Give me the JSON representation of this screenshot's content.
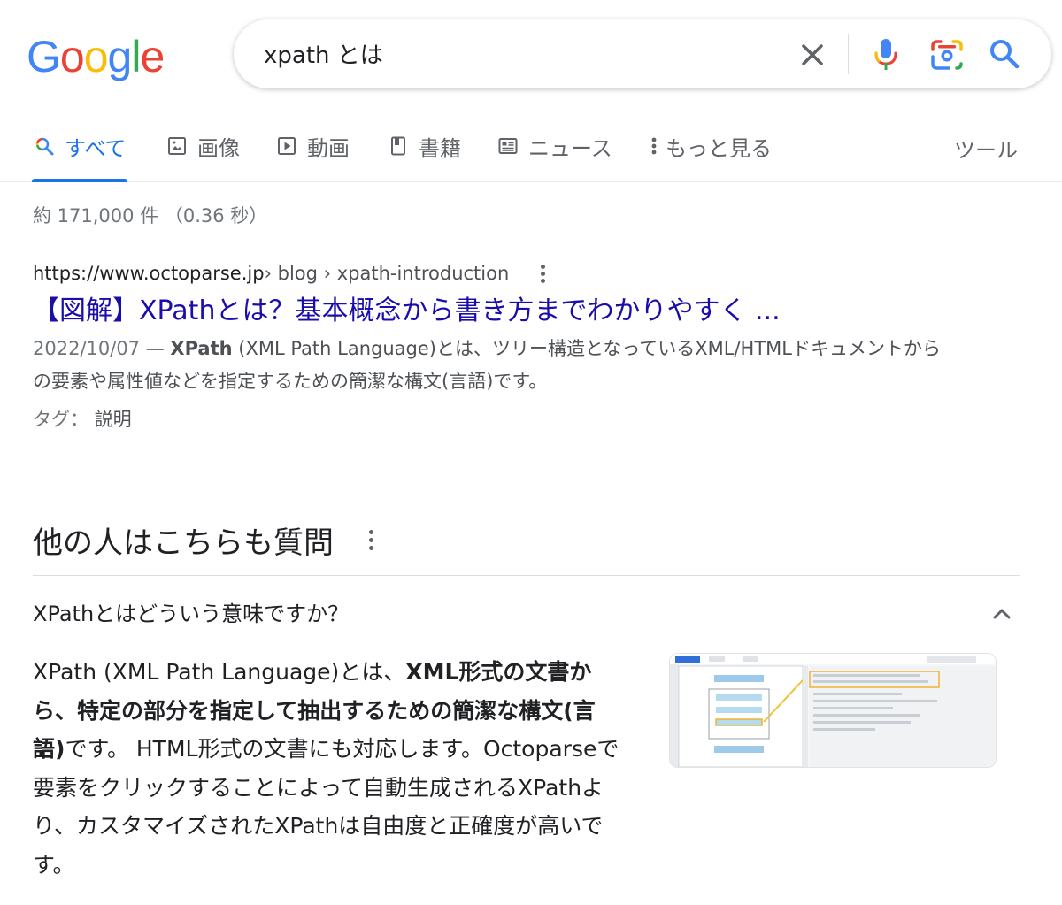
{
  "logo": {
    "letters": [
      "G",
      "o",
      "o",
      "g",
      "l",
      "e"
    ]
  },
  "search": {
    "query": "xpath とは"
  },
  "tabs": [
    {
      "label": "すべて",
      "icon": "search-icon",
      "active": true
    },
    {
      "label": "画像",
      "icon": "image-icon"
    },
    {
      "label": "動画",
      "icon": "video-icon"
    },
    {
      "label": "書籍",
      "icon": "book-icon"
    },
    {
      "label": "ニュース",
      "icon": "news-icon"
    },
    {
      "label": "もっと見る",
      "icon": "more-vert-icon"
    }
  ],
  "tools_label": "ツール",
  "stats": "約 171,000 件 （0.36 秒）",
  "result": {
    "cite_domain": "https://www.octoparse.jp",
    "cite_path": " › blog › xpath-introduction",
    "title": "【図解】XPathとは？基本概念から書き方までわかりやすく ...",
    "date": "2022/10/07 — ",
    "snippet_bold": "XPath",
    "snippet_rest": " (XML Path Language)とは、ツリー構造となっているXML/HTMLドキュメントからの要素や属性値などを指定するための簡潔な構文(言語)です。",
    "tags_label": "タグ： ",
    "tags_value": "説明"
  },
  "paa": {
    "heading": "他の人はこちらも質問",
    "question": "XPathとはどういう意味ですか？",
    "answer_1": "XPath (XML Path Language)とは、",
    "answer_bold": "XML形式の文書から、特定の部分を指定して抽出するための簡潔な構文(言語)",
    "answer_2": "です。 HTML形式の文書にも対応します。Octoparseで要素をクリックすることによって自動生成されるXPathより、カスタマイズされたXPathは自由度と正確度が高いです。"
  },
  "colors": {
    "accent": "#1a73e8",
    "link": "#1a0dab",
    "text": "#202124",
    "muted": "#70757a"
  }
}
